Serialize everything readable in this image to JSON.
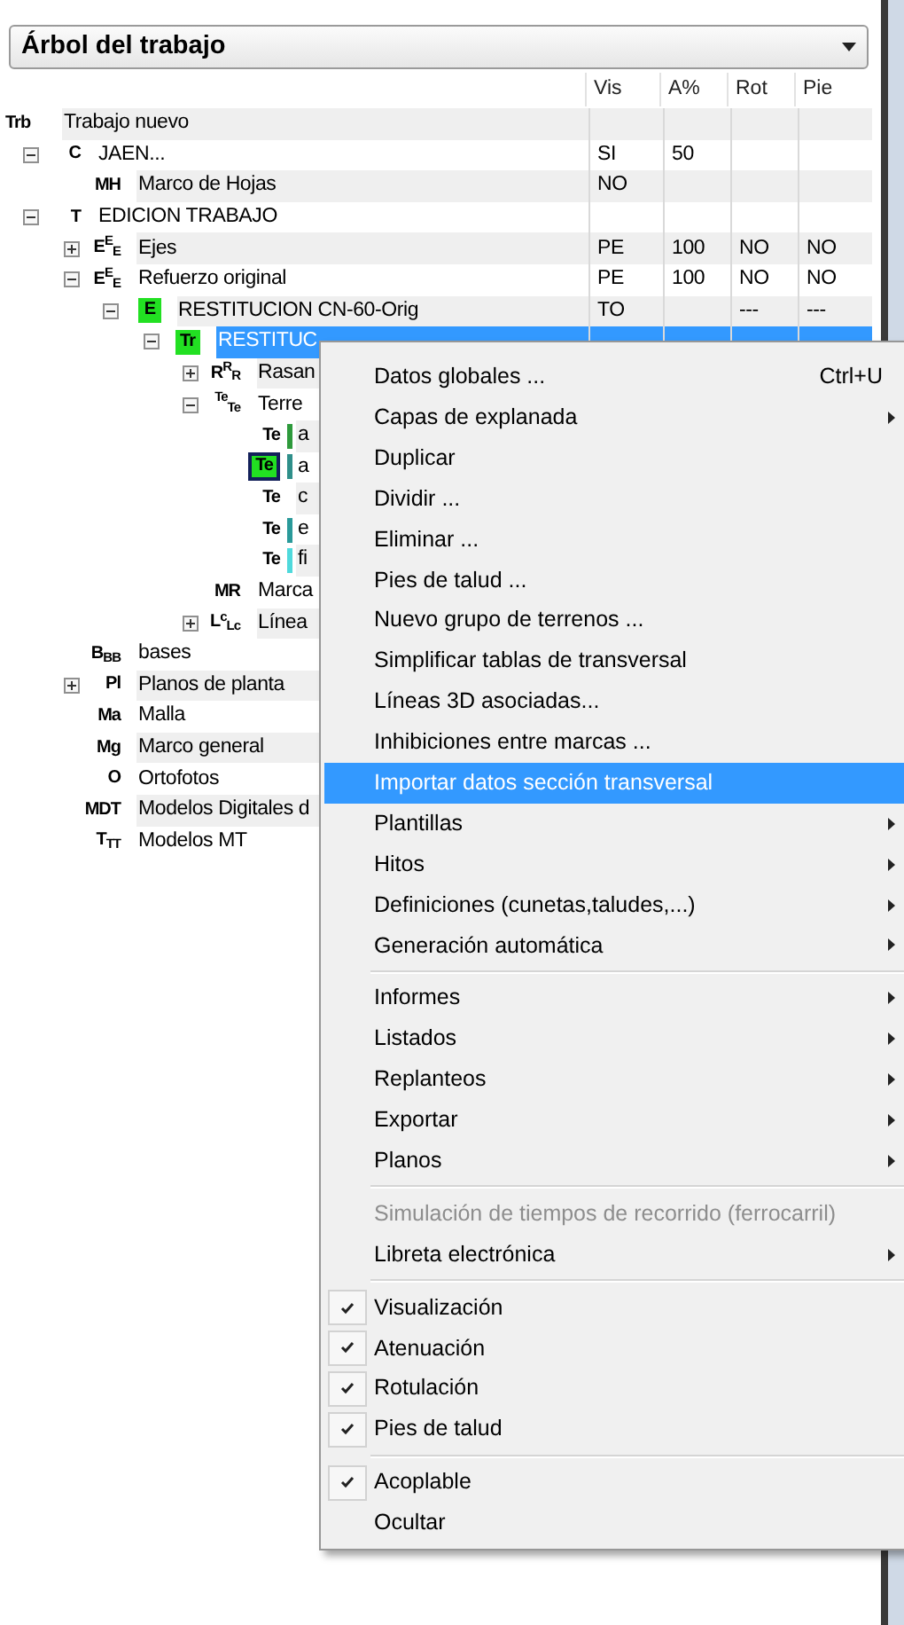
{
  "panel": {
    "title": "Árbol del trabajo"
  },
  "columns": [
    "Vis",
    "A%",
    "Rot",
    "Pie"
  ],
  "tree": [
    {
      "icon": "Trb",
      "highlighted": false,
      "framed": false,
      "label": "Trabajo nuevo",
      "selected": false,
      "children": [
        {
          "icon": "C",
          "highlighted": false,
          "framed": false,
          "label": "JAEN...",
          "expanded": true,
          "selected": false,
          "cells": [
            "SI",
            "50",
            "",
            ""
          ],
          "children": [
            {
              "icon": "MH",
              "highlighted": false,
              "framed": false,
              "label": "Marco de Hojas",
              "selected": false,
              "cells": [
                "NO",
                "",
                "",
                ""
              ]
            }
          ]
        },
        {
          "icon": "T",
          "highlighted": false,
          "framed": false,
          "label": "EDICION TRABAJO",
          "expanded": true,
          "selected": false,
          "children": [
            {
              "icon": "E$^{E}$$_{E}$",
              "highlighted": false,
              "framed": false,
              "label": "Ejes",
              "expanded": false,
              "selected": false,
              "cells": [
                "PE",
                "100",
                "NO",
                "NO"
              ]
            },
            {
              "icon": "E$^{E}$$_{E}$",
              "highlighted": false,
              "framed": false,
              "label": "Refuerzo original",
              "expanded": true,
              "selected": false,
              "cells": [
                "PE",
                "100",
                "NO",
                "NO"
              ],
              "children": [
                {
                  "icon": "E",
                  "highlighted": true,
                  "framed": false,
                  "label": "RESTITUCION CN-60-Orig",
                  "expanded": true,
                  "selected": false,
                  "cells": [
                    "TO",
                    "",
                    "---",
                    "---"
                  ],
                  "children": [
                    {
                      "icon": "Tr",
                      "highlighted": true,
                      "framed": false,
                      "label": "RESTITUC",
                      "expanded": true,
                      "selected": true,
                      "children": [
                        {
                          "icon": "R$^{R}$$_{R}$",
                          "highlighted": false,
                          "framed": false,
                          "label": "Rasan",
                          "expanded": false,
                          "selected": false
                        },
                        {
                          "icon": "$^{Te}$$_{Te}$",
                          "highlighted": false,
                          "framed": false,
                          "label": "Terre",
                          "expanded": true,
                          "selected": false,
                          "children": [
                            {
                              "icon": "Te",
                              "highlighted": false,
                              "framed": false,
                              "label": "a",
                              "color": "#2e9a3c",
                              "selected": false
                            },
                            {
                              "icon": "Te",
                              "highlighted": true,
                              "framed": true,
                              "label": "a",
                              "color": "#2f8f8a",
                              "selected": false
                            },
                            {
                              "icon": "Te",
                              "highlighted": false,
                              "framed": false,
                              "label": "c",
                              "selected": false
                            },
                            {
                              "icon": "Te",
                              "highlighted": false,
                              "framed": false,
                              "label": "e",
                              "color": "#2a9a9a",
                              "selected": false
                            },
                            {
                              "icon": "Te",
                              "highlighted": false,
                              "framed": false,
                              "label": "fi",
                              "color": "#4fd9dc",
                              "selected": false
                            }
                          ]
                        },
                        {
                          "icon": "MR",
                          "highlighted": false,
                          "framed": false,
                          "label": "Marca",
                          "selected": false
                        },
                        {
                          "icon": "L$^{c}$$_{Lc}$",
                          "highlighted": false,
                          "framed": false,
                          "label": "Línea",
                          "expanded": false,
                          "selected": false
                        }
                      ]
                    }
                  ]
                }
              ]
            },
            {
              "icon": "B$_{B}$$_{B}$",
              "highlighted": false,
              "framed": false,
              "label": "bases",
              "selected": false
            },
            {
              "icon": "Pl",
              "highlighted": false,
              "framed": false,
              "label": "Planos de planta",
              "expanded": false,
              "selected": false
            },
            {
              "icon": "Ma",
              "highlighted": false,
              "framed": false,
              "label": "Malla",
              "selected": false
            },
            {
              "icon": "Mg",
              "highlighted": false,
              "framed": false,
              "label": "Marco general",
              "selected": false
            },
            {
              "icon": "O",
              "highlighted": false,
              "framed": false,
              "label": "Ortofotos",
              "selected": false
            },
            {
              "icon": "MDT",
              "highlighted": false,
              "framed": false,
              "label": "Modelos Digitales d",
              "selected": false
            },
            {
              "icon": "T$_{T}$$_{T}$",
              "highlighted": false,
              "framed": false,
              "label": "Modelos MT",
              "selected": false
            }
          ]
        }
      ]
    }
  ],
  "context_menu": {
    "groups": [
      [
        {
          "label": "Datos globales ...",
          "shortcut": "Ctrl+U",
          "submenu": false,
          "checked": false,
          "disabled": false,
          "selected": false
        },
        {
          "label": "Capas de explanada",
          "submenu": true,
          "checked": false,
          "disabled": false,
          "selected": false
        },
        {
          "label": "Duplicar",
          "submenu": false,
          "checked": false,
          "disabled": false,
          "selected": false
        },
        {
          "label": "Dividir ...",
          "submenu": false,
          "checked": false,
          "disabled": false,
          "selected": false
        },
        {
          "label": "Eliminar ...",
          "submenu": false,
          "checked": false,
          "disabled": false,
          "selected": false
        },
        {
          "label": "Pies de talud ...",
          "submenu": false,
          "checked": false,
          "disabled": false,
          "selected": false
        },
        {
          "label": "Nuevo grupo de terrenos ...",
          "submenu": false,
          "checked": false,
          "disabled": false,
          "selected": false
        },
        {
          "label": "Simplificar tablas de transversal",
          "submenu": false,
          "checked": false,
          "disabled": false,
          "selected": false
        },
        {
          "label": "Líneas 3D asociadas...",
          "submenu": false,
          "checked": false,
          "disabled": false,
          "selected": false
        },
        {
          "label": "Inhibiciones entre marcas ...",
          "submenu": false,
          "checked": false,
          "disabled": false,
          "selected": false
        },
        {
          "label": "Importar datos sección transversal",
          "submenu": false,
          "checked": false,
          "disabled": false,
          "selected": true
        },
        {
          "label": "Plantillas",
          "submenu": true,
          "checked": false,
          "disabled": false,
          "selected": false
        },
        {
          "label": "Hitos",
          "submenu": true,
          "checked": false,
          "disabled": false,
          "selected": false
        },
        {
          "label": "Definiciones (cunetas,taludes,...)",
          "submenu": true,
          "checked": false,
          "disabled": false,
          "selected": false
        },
        {
          "label": "Generación automática",
          "submenu": true,
          "checked": false,
          "disabled": false,
          "selected": false
        }
      ],
      [
        {
          "label": "Informes",
          "submenu": true,
          "checked": false,
          "disabled": false,
          "selected": false
        },
        {
          "label": "Listados",
          "submenu": true,
          "checked": false,
          "disabled": false,
          "selected": false
        },
        {
          "label": "Replanteos",
          "submenu": true,
          "checked": false,
          "disabled": false,
          "selected": false
        },
        {
          "label": "Exportar",
          "submenu": true,
          "checked": false,
          "disabled": false,
          "selected": false
        },
        {
          "label": "Planos",
          "submenu": true,
          "checked": false,
          "disabled": false,
          "selected": false
        }
      ],
      [
        {
          "label": "Simulación de tiempos de recorrido (ferrocarril)",
          "submenu": false,
          "checked": false,
          "disabled": true,
          "selected": false
        },
        {
          "label": "Libreta electrónica",
          "submenu": true,
          "checked": false,
          "disabled": false,
          "selected": false
        }
      ],
      [
        {
          "label": "Visualización",
          "submenu": false,
          "checked": true,
          "disabled": false,
          "selected": false
        },
        {
          "label": "Atenuación",
          "submenu": false,
          "checked": true,
          "disabled": false,
          "selected": false
        },
        {
          "label": "Rotulación",
          "submenu": false,
          "checked": true,
          "disabled": false,
          "selected": false
        },
        {
          "label": "Pies de talud",
          "submenu": false,
          "checked": true,
          "disabled": false,
          "selected": false
        }
      ],
      [
        {
          "label": "Acoplable",
          "submenu": false,
          "checked": true,
          "disabled": false,
          "selected": false
        },
        {
          "label": "Ocultar",
          "submenu": false,
          "checked": false,
          "disabled": false,
          "selected": false
        }
      ]
    ]
  }
}
